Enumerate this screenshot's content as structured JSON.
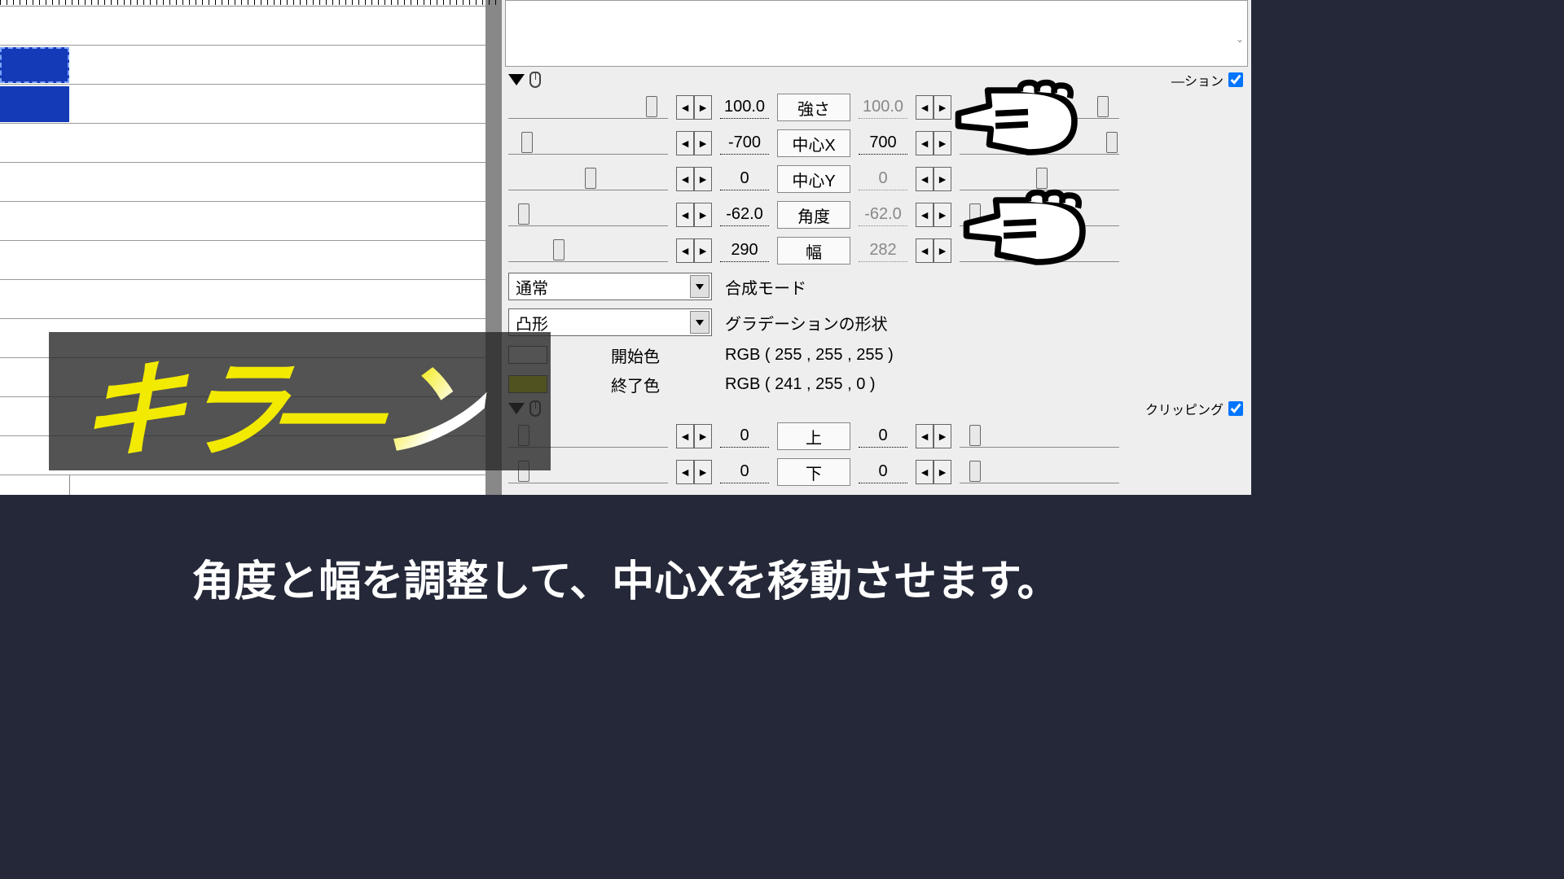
{
  "section1": {
    "checkbox_label": "—ション",
    "params": [
      {
        "label": "強さ",
        "val_left": "100.0",
        "val_right": "100.0",
        "thumb_left_pct": 86,
        "thumb_right_pct": 86,
        "right_dim": true
      },
      {
        "label": "中心X",
        "val_left": "-700",
        "val_right": "700",
        "thumb_left_pct": 8,
        "thumb_right_pct": 92,
        "right_dim": false
      },
      {
        "label": "中心Y",
        "val_left": "0",
        "val_right": "0",
        "thumb_left_pct": 48,
        "thumb_right_pct": 48,
        "right_dim": true
      },
      {
        "label": "角度",
        "val_left": "-62.0",
        "val_right": "-62.0",
        "thumb_left_pct": 6,
        "thumb_right_pct": 6,
        "right_dim": true
      },
      {
        "label": "幅",
        "val_left": "290",
        "val_right": "282",
        "thumb_left_pct": 28,
        "thumb_right_pct": 28,
        "right_dim": true
      }
    ],
    "dropdowns": [
      {
        "value": "通常",
        "label": "合成モード"
      },
      {
        "value": "凸形",
        "label": "グラデーションの形状"
      }
    ],
    "colors": [
      {
        "label": "開始色",
        "value": "RGB ( 255 , 255 , 255 )",
        "hex": "#ffffff"
      },
      {
        "label": "終了色",
        "value": "RGB ( 241 , 255 , 0 )",
        "hex": "#f1ff00"
      }
    ]
  },
  "section2": {
    "checkbox_label": "クリッピング",
    "params": [
      {
        "label": "上",
        "val_left": "0",
        "val_right": "0",
        "thumb_left_pct": 6,
        "thumb_right_pct": 6
      },
      {
        "label": "下",
        "val_left": "0",
        "val_right": "0",
        "thumb_left_pct": 6,
        "thumb_right_pct": 6
      }
    ]
  },
  "overlay_kira": "キラーン",
  "caption": "角度と幅を調整して、中心Xを移動させます。"
}
